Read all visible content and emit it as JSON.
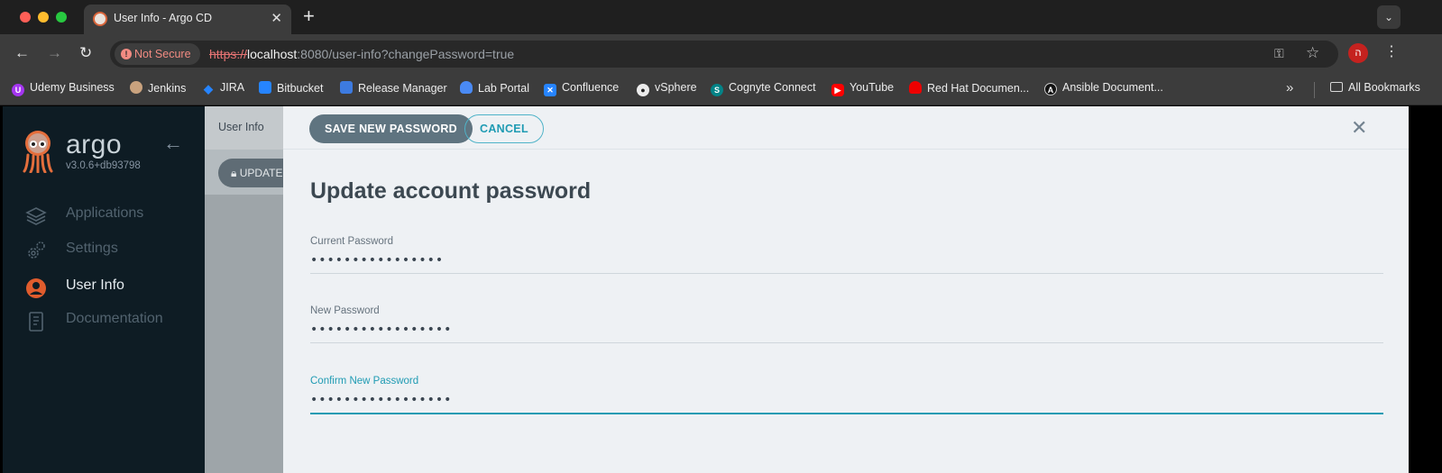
{
  "browser": {
    "tab_title": "User Info - Argo CD",
    "tab_close": "✕",
    "new_tab": "+",
    "security_label": "Not Secure",
    "url_scheme": "https://",
    "url_host": "localhost",
    "url_rest": ":8080/user-info?changePassword=true",
    "profile_initial": "ה",
    "bookmarks": [
      {
        "label": "Udemy Business",
        "icon": "udemy-icon",
        "color": "#a435f0"
      },
      {
        "label": "Jenkins",
        "icon": "jenkins-icon",
        "color": "#d33833"
      },
      {
        "label": "JIRA",
        "icon": "jira-icon",
        "color": "#2684ff"
      },
      {
        "label": "Bitbucket",
        "icon": "bitbucket-icon",
        "color": "#2684ff"
      },
      {
        "label": "Release Manager",
        "icon": "release-manager-icon",
        "color": "#3d7be0"
      },
      {
        "label": "Lab Portal",
        "icon": "cloud-icon",
        "color": "#4a8af4"
      },
      {
        "label": "Confluence",
        "icon": "confluence-icon",
        "color": "#2684ff"
      },
      {
        "label": "vSphere",
        "icon": "globe-icon",
        "color": "#ececec"
      },
      {
        "label": "Cognyte Connect",
        "icon": "sharepoint-icon",
        "color": "#038387"
      },
      {
        "label": "YouTube",
        "icon": "youtube-icon",
        "color": "#ff0000"
      },
      {
        "label": "Red Hat Documen...",
        "icon": "redhat-icon",
        "color": "#ee0000"
      },
      {
        "label": "Ansible Document...",
        "icon": "ansible-icon",
        "color": "#1a1a1a"
      }
    ],
    "more_bookmarks": "»",
    "all_bookmarks": "All Bookmarks"
  },
  "sidebar": {
    "brand": "argo",
    "version": "v3.0.6+db93798",
    "items": [
      {
        "label": "Applications",
        "icon": "layers-icon",
        "active": false
      },
      {
        "label": "Settings",
        "icon": "gears-icon",
        "active": false
      },
      {
        "label": "User Info",
        "icon": "user-circle-icon",
        "active": true
      },
      {
        "label": "Documentation",
        "icon": "book-icon",
        "active": false
      }
    ]
  },
  "page": {
    "title": "User Info",
    "update_button": "UPDATE PASSWORD"
  },
  "panel": {
    "save_label": "SAVE NEW PASSWORD",
    "cancel_label": "CANCEL",
    "close": "✕",
    "heading": "Update account password",
    "fields": [
      {
        "label": "Current Password",
        "value": "••••••••••••••••",
        "focused": false
      },
      {
        "label": "New Password",
        "value": "•••••••••••••••••",
        "focused": false
      },
      {
        "label": "Confirm New Password",
        "value": "•••••••••••••••••",
        "focused": true
      }
    ]
  },
  "colors": {
    "accent": "#1f9bb3",
    "sidebar_bg": "#0e1c24",
    "panel_bg": "#eef1f4",
    "primary_button": "#5f7480"
  }
}
